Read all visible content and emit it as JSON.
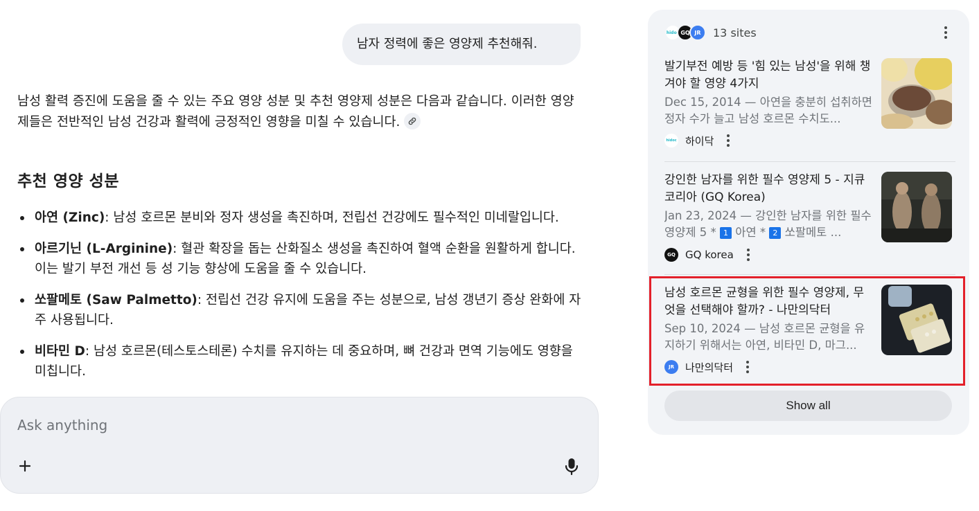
{
  "user_message": "남자 정력에 좋은 영양제 추천해줘.",
  "answer": {
    "intro": "남성 활력 증진에 도움을 줄 수 있는 주요 영양 성분 및 추천 영양제 성분은 다음과 같습니다. 이러한 영양제들은 전반적인 남성 건강과 활력에 긍정적인 영향을 미칠 수 있습니다.",
    "heading": "추천 영양 성분",
    "items": [
      {
        "name": "아연 (Zinc)",
        "text": ": 남성 호르몬 분비와 정자 생성을 촉진하며, 전립선 건강에도 필수적인 미네랄입니다."
      },
      {
        "name": "아르기닌 (L-Arginine)",
        "text": ": 혈관 확장을 돕는 산화질소 생성을 촉진하여 혈액 순환을 원활하게 합니다. 이는 발기 부전 개선 등 성 기능 향상에 도움을 줄 수 있습니다."
      },
      {
        "name": "쏘팔메토 (Saw Palmetto)",
        "text": ": 전립선 건강 유지에 도움을 주는 성분으로, 남성 갱년기 증상 완화에 자주 사용됩니다."
      },
      {
        "name": "비타민 D",
        "text": ": 남성 호르몬(테스토스테론) 수치를 유지하는 데 중요하며, 뼈 건강과 면역 기능에도 영향을 미칩니다."
      }
    ]
  },
  "composer": {
    "placeholder": "Ask anything",
    "plus_icon": "+"
  },
  "sources": {
    "count_label": "13 sites",
    "favicons": [
      "hidoc",
      "GQ",
      "JR"
    ],
    "cards": [
      {
        "title": "발기부전 예방 등 '힘 있는 남성'을 위해 챙겨야 할 영양 4가지",
        "snippet": "Dec 15, 2014 — 아연을 충분히 섭취하면 정자 수가 늘고 남성 호르몬 수치도...",
        "source": "하이닥",
        "favicon": "hidoc"
      },
      {
        "title": "강인한 남자를 위한 필수 영양제 5 - 지큐 코리아 (GQ Korea)",
        "snippet_pre": "Jan 23, 2024 — 강인한 남자를 위한 필수 영양제 5 * ",
        "badge1": "1",
        "snippet_mid": " 아연 * ",
        "badge2": "2",
        "snippet_post": " 쏘팔메토 ...",
        "source": "GQ korea",
        "favicon": "GQ"
      },
      {
        "title": "남성 호르몬 균형을 위한 필수 영양제, 무엇을 선택해야 할까? - 나만의닥터",
        "snippet": "Sep 10, 2024 — 남성 호르몬 균형을 유지하기 위해서는 아연, 비타민 D, 마그...",
        "source": "나만의닥터",
        "favicon": "JR"
      }
    ],
    "show_all_label": "Show all"
  },
  "colors": {
    "highlight_border": "#e3202a",
    "panel_bg": "#f2f4f7",
    "badge_blue": "#1a73e8"
  }
}
